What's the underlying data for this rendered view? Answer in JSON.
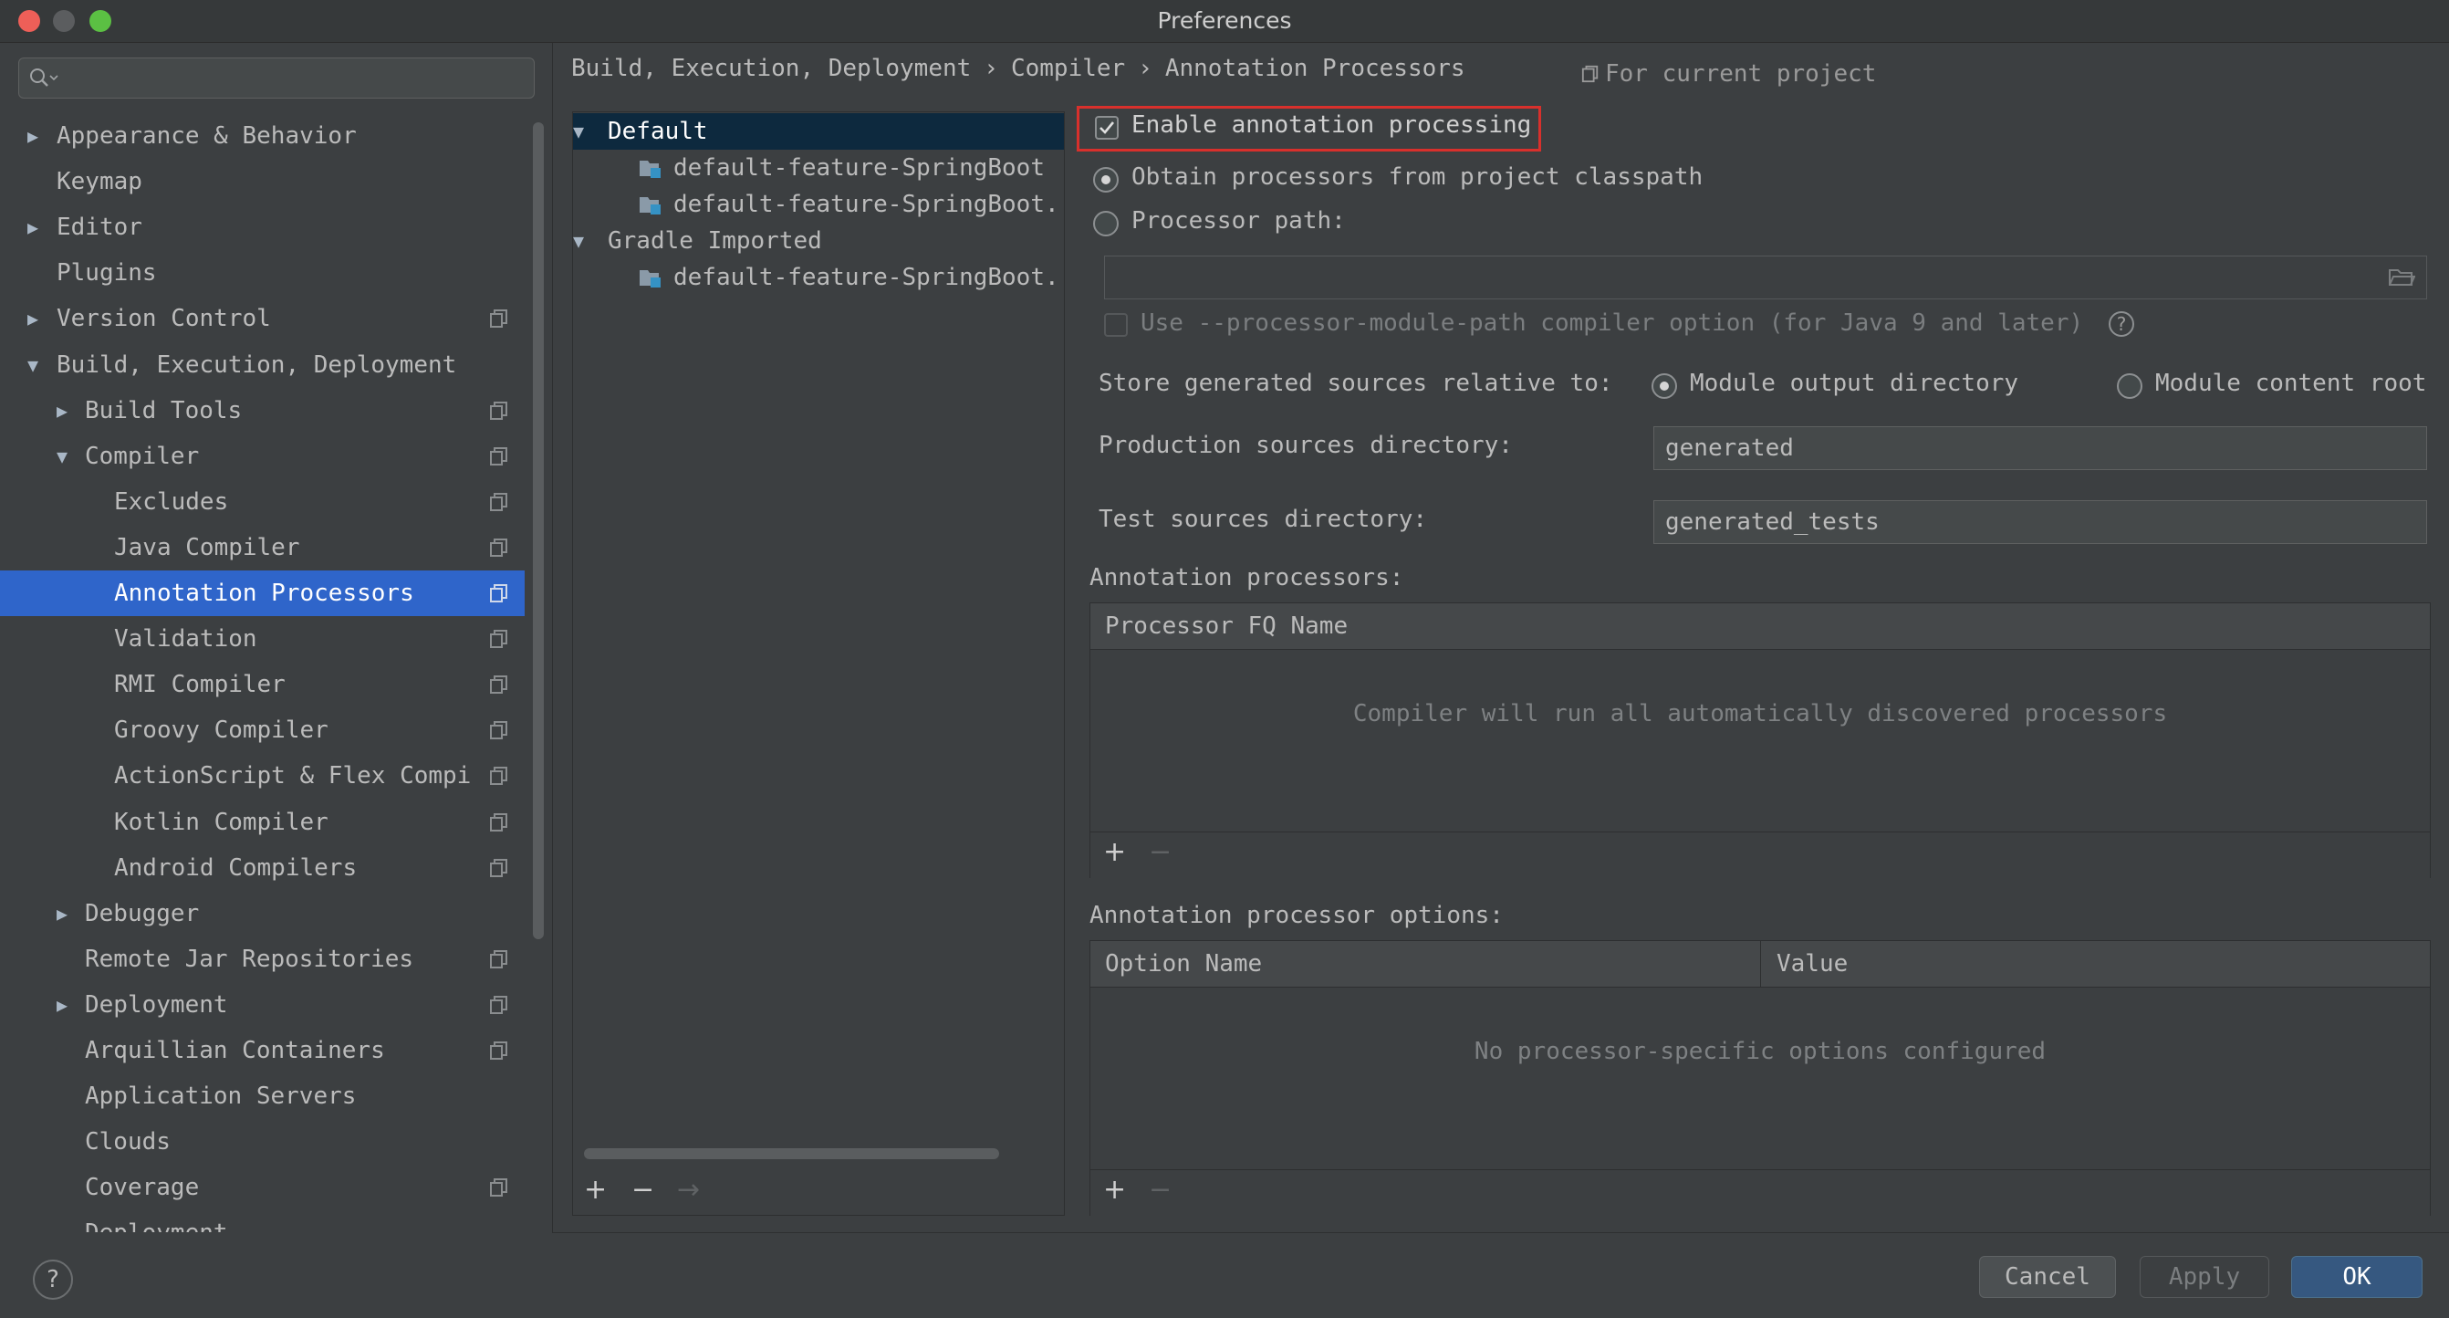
{
  "window": {
    "title": "Preferences",
    "traffic_lights": {
      "close": "#ee5f58",
      "minimize": "#5b5d5f",
      "maximize": "#5bc043"
    }
  },
  "search": {
    "icon": "search-icon",
    "value": ""
  },
  "sidebar": {
    "items": [
      {
        "label": "Appearance & Behavior",
        "level": 0,
        "arrow": "▶",
        "project": false
      },
      {
        "label": "Keymap",
        "level": 0,
        "arrow": "",
        "project": false
      },
      {
        "label": "Editor",
        "level": 0,
        "arrow": "▶",
        "project": false
      },
      {
        "label": "Plugins",
        "level": 0,
        "arrow": "",
        "project": false
      },
      {
        "label": "Version Control",
        "level": 0,
        "arrow": "▶",
        "project": true
      },
      {
        "label": "Build, Execution, Deployment",
        "level": 0,
        "arrow": "▼",
        "project": false
      },
      {
        "label": "Build Tools",
        "level": 1,
        "arrow": "▶",
        "project": true
      },
      {
        "label": "Compiler",
        "level": 1,
        "arrow": "▼",
        "project": true
      },
      {
        "label": "Excludes",
        "level": 2,
        "arrow": "",
        "project": true
      },
      {
        "label": "Java Compiler",
        "level": 2,
        "arrow": "",
        "project": true
      },
      {
        "label": "Annotation Processors",
        "level": 2,
        "arrow": "",
        "project": true,
        "selected": true
      },
      {
        "label": "Validation",
        "level": 2,
        "arrow": "",
        "project": true
      },
      {
        "label": "RMI Compiler",
        "level": 2,
        "arrow": "",
        "project": true
      },
      {
        "label": "Groovy Compiler",
        "level": 2,
        "arrow": "",
        "project": true
      },
      {
        "label": "ActionScript & Flex Compi",
        "level": 2,
        "arrow": "",
        "project": true
      },
      {
        "label": "Kotlin Compiler",
        "level": 2,
        "arrow": "",
        "project": true
      },
      {
        "label": "Android Compilers",
        "level": 2,
        "arrow": "",
        "project": true
      },
      {
        "label": "Debugger",
        "level": 1,
        "arrow": "▶",
        "project": false
      },
      {
        "label": "Remote Jar Repositories",
        "level": 1,
        "arrow": "",
        "project": true
      },
      {
        "label": "Deployment",
        "level": 1,
        "arrow": "▶",
        "project": true
      },
      {
        "label": "Arquillian Containers",
        "level": 1,
        "arrow": "",
        "project": true
      },
      {
        "label": "Application Servers",
        "level": 1,
        "arrow": "",
        "project": false
      },
      {
        "label": "Clouds",
        "level": 1,
        "arrow": "",
        "project": false
      },
      {
        "label": "Coverage",
        "level": 1,
        "arrow": "",
        "project": true
      },
      {
        "label": "Deployment",
        "level": 1,
        "arrow": "",
        "project": false
      }
    ]
  },
  "breadcrumb": {
    "parts": [
      "Build, Execution, Deployment",
      "Compiler",
      "Annotation Processors"
    ],
    "separator": "›",
    "scope_label": "For current project"
  },
  "module_tree": {
    "rows": [
      {
        "label": "Default",
        "type": "group",
        "arrow": "▼",
        "selected": true
      },
      {
        "label": "default-feature-SpringBoot",
        "type": "module"
      },
      {
        "label": "default-feature-SpringBoot.",
        "type": "module"
      },
      {
        "label": "Gradle Imported",
        "type": "group",
        "arrow": "▼"
      },
      {
        "label": "default-feature-SpringBoot.",
        "type": "module"
      }
    ],
    "toolbar": {
      "add": "+",
      "remove": "−",
      "move": "→"
    }
  },
  "options": {
    "enable_processing": {
      "label": "Enable annotation processing",
      "checked": true
    },
    "obtain_from_classpath": {
      "label": "Obtain processors from project classpath",
      "selected": true
    },
    "processor_path": {
      "label": "Processor path:",
      "selected": false,
      "value": ""
    },
    "module_path_option": {
      "label": "Use --processor-module-path compiler option (for Java 9 and later)",
      "checked": false,
      "help": "?"
    },
    "store_relative": {
      "label": "Store generated sources relative to:",
      "module_output": "Module output directory",
      "module_content": "Module content root",
      "selected": "Module output directory"
    },
    "production_dir": {
      "label": "Production sources directory:",
      "value": "generated"
    },
    "test_dir": {
      "label": "Test sources directory:",
      "value": "generated_tests"
    }
  },
  "processors_table": {
    "title": "Annotation processors:",
    "column": "Processor FQ Name",
    "empty": "Compiler will run all automatically discovered processors",
    "add": "+",
    "remove": "−"
  },
  "options_table": {
    "title": "Annotation processor options:",
    "columns": [
      "Option Name",
      "Value"
    ],
    "empty": "No processor-specific options configured",
    "add": "+",
    "remove": "−"
  },
  "buttons": {
    "cancel": "Cancel",
    "apply": "Apply",
    "ok": "OK",
    "help": "?"
  },
  "colors": {
    "selection": "#2f65ca",
    "highlight_box": "#d8302c",
    "primary_button": "#365880"
  }
}
